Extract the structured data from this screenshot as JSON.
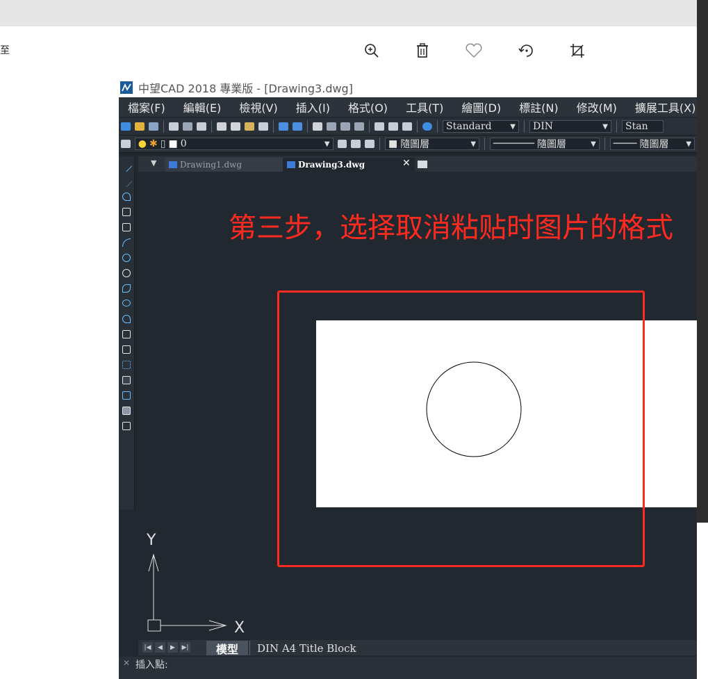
{
  "viewer": {
    "edge_text": "至",
    "toolbar_icons": [
      "zoom-in-icon",
      "trash-icon",
      "heart-icon",
      "rotate-icon",
      "crop-icon"
    ]
  },
  "cad": {
    "title": "中望CAD 2018 專業版 - [Drawing3.dwg]",
    "menu": [
      "檔案(F)",
      "編輯(E)",
      "檢視(V)",
      "插入(I)",
      "格式(O)",
      "工具(T)",
      "繪圖(D)",
      "標註(N)",
      "修改(M)",
      "擴展工具(X)"
    ],
    "toolbar1": {
      "text_style": "Standard",
      "dim_style": "DIN",
      "table_style": "Stan"
    },
    "toolbar2": {
      "layer": "0",
      "color": "隨圖層",
      "linetype": "隨圖層",
      "lineweight": "隨圖層"
    },
    "tabs": [
      {
        "label": "Drawing1.dwg",
        "active": false
      },
      {
        "label": "Drawing3.dwg",
        "active": true
      }
    ],
    "instruction_text": "第三步，选择取消粘贴时图片的格式",
    "ucs": {
      "x_label": "X",
      "y_label": "Y"
    },
    "layout_tabs": {
      "model": "模型",
      "layout": "DIN A4 Title Block"
    },
    "command_line": "插入點:"
  },
  "colors": {
    "accent_red": "#ff2a1f",
    "cad_bg": "#212830",
    "tool_blue": "#66c0ff"
  }
}
